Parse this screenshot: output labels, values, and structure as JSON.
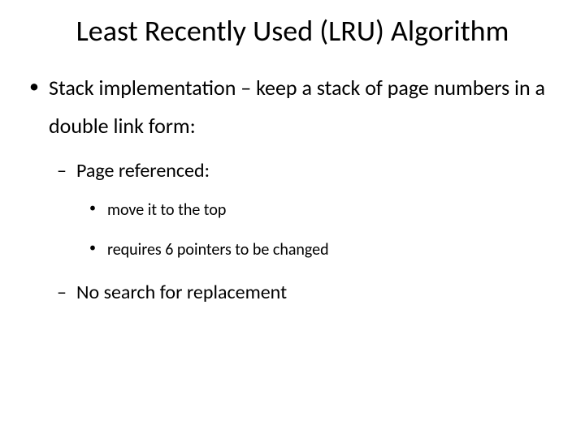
{
  "title": "Least Recently Used (LRU) Algorithm",
  "bullets": {
    "l1_0": "Stack implementation – keep a stack of page numbers in a double link form:",
    "l2_0": "Page referenced:",
    "l3_0": "move it to the top",
    "l3_1": "requires 6 pointers to be changed",
    "l2_1": "No search for replacement"
  }
}
